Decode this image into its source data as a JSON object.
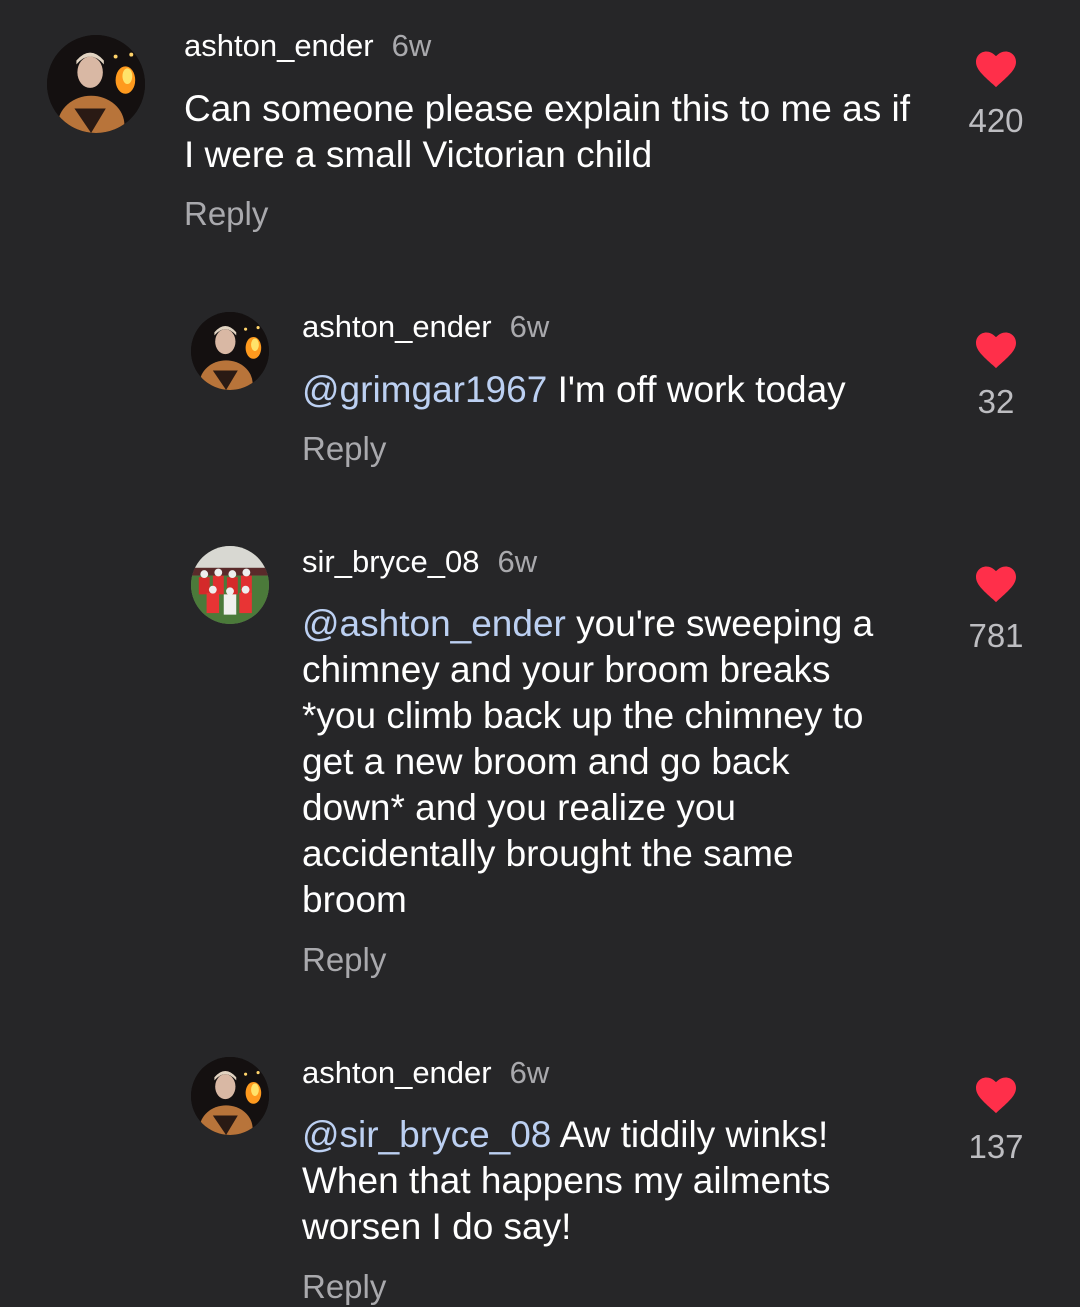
{
  "colors": {
    "background": "#262628",
    "heart": "#ff2f4a",
    "mention": "#bcd0f2",
    "secondary_text": "#a9a9ad"
  },
  "comments": [
    {
      "username": "ashton_ender",
      "time": "6w",
      "mention": "",
      "text": "Can someone please explain this to me as if I were a small Victorian child",
      "reply_label": "Reply",
      "likes": "420",
      "avatar_icon": "avatar-fire-photo-icon"
    },
    {
      "username": "ashton_ender",
      "time": "6w",
      "mention": "@grimgar1967",
      "text": " I'm off work today",
      "reply_label": "Reply",
      "likes": "32",
      "avatar_icon": "avatar-fire-photo-icon"
    },
    {
      "username": "sir_bryce_08",
      "time": "6w",
      "mention": "@ashton_ender",
      "text": " you're sweeping a chimney and your broom breaks *you climb back up the chimney to get a new broom and go back down* and you realize you accidentally brought the same broom",
      "reply_label": "Reply",
      "likes": "781",
      "avatar_icon": "avatar-football-team-photo-icon"
    },
    {
      "username": "ashton_ender",
      "time": "6w",
      "mention": "@sir_bryce_08",
      "text": " Aw tiddily winks! When that happens my ailments worsen I do say!",
      "reply_label": "Reply",
      "likes": "137",
      "avatar_icon": "avatar-fire-photo-icon"
    }
  ]
}
